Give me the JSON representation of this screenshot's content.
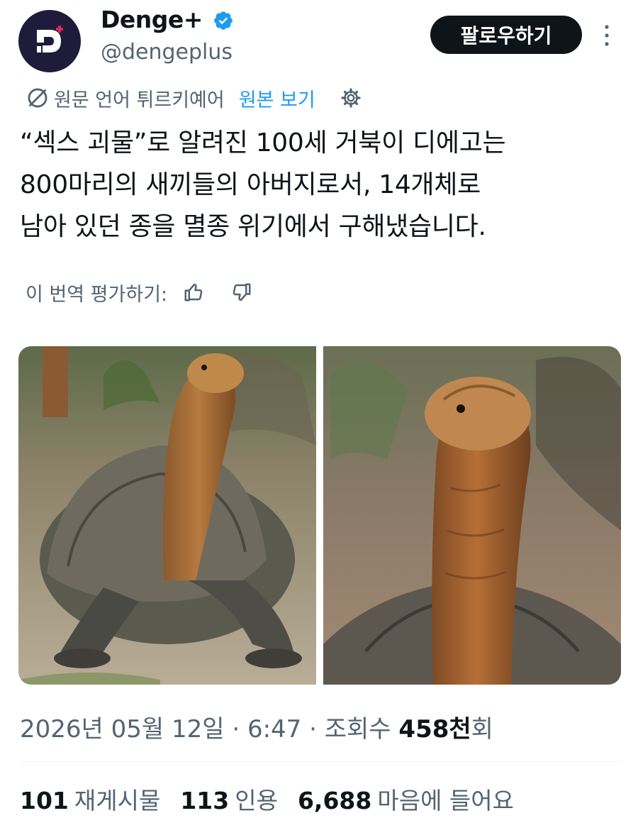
{
  "account": {
    "display_name": "Denge+",
    "handle": "@dengeplus",
    "avatar_letter": "D"
  },
  "header": {
    "follow_label": "팔로우하기"
  },
  "translation": {
    "notice": "원문 언어 튀르키예어",
    "show_original": "원본 보기"
  },
  "tweet": {
    "lines": [
      "“섹스 괴물”로 알려진 100세 거북이 디에고는",
      "800마리의 새끼들의 아버지로서, 14개체로",
      "남아 있던 종을 멸종 위기에서 구해냈습니다."
    ]
  },
  "rating": {
    "label": "이 번역 평가하기:"
  },
  "meta": {
    "date": "2026년 05월 12일",
    "sep1": " · ",
    "time": "6:47",
    "sep2": " · ",
    "views_label": "조회수 ",
    "views_count": "458천",
    "views_suffix": "회"
  },
  "stats": {
    "reposts_count": "101",
    "reposts_label": "재게시물",
    "quotes_count": "113",
    "quotes_label": "인용",
    "likes_count": "6,688",
    "likes_label": "마음에 들어요"
  },
  "colors": {
    "accent": "#1d9bf0",
    "text": "#0f1419",
    "muted": "#536471",
    "avatar_bg": "#1f1b3a",
    "follow_bg": "#0f1419"
  },
  "icons": [
    "verified-badge-icon",
    "more-icon",
    "globe-slash-icon",
    "gear-icon",
    "thumbs-up-icon",
    "thumbs-down-icon"
  ]
}
